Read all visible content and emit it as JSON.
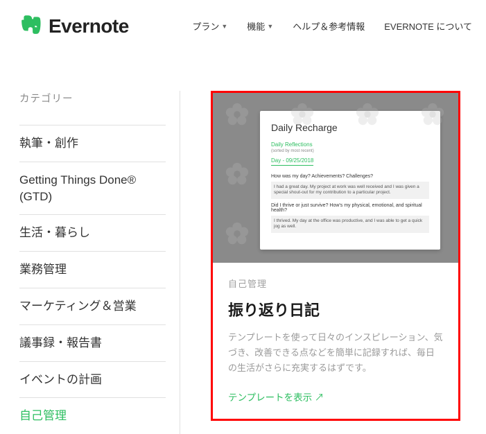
{
  "header": {
    "brand": "Evernote",
    "nav": {
      "plan": "プラン",
      "features": "機能",
      "help": "ヘルプ＆参考情報",
      "about": "EVERNOTE について"
    }
  },
  "sidebar": {
    "heading": "カテゴリー",
    "items": [
      "執筆・創作",
      "Getting Things Done® (GTD)",
      "生活・暮らし",
      "業務管理",
      "マーケティング＆営業",
      "議事録・報告書",
      "イベントの計画",
      "自己管理"
    ]
  },
  "card": {
    "category": "自己管理",
    "title": "振り返り日記",
    "description": "テンプレートを使って日々のインスピレーション、気づき、改善できる点などを簡単に記録すれば、毎日の生活がさらに充実するはずです。",
    "link": "テンプレートを表示 ↗"
  },
  "preview": {
    "title": "Daily Recharge",
    "h1": "Daily Reflections",
    "sub": "(sorted by most recent)",
    "h2": "Day - 09/25/2018",
    "q1": "How was my day? Achievements? Challenges?",
    "a1": "I had a great day. My project at work was well received and I was given a special shout-out for my contribution to a particular project.",
    "q2": "Did I thrive or just survive? How's my physical, emotional, and spiritual health?",
    "a2": "I thrived. My day at the office was productive, and I was able to get a quick jog as well."
  }
}
